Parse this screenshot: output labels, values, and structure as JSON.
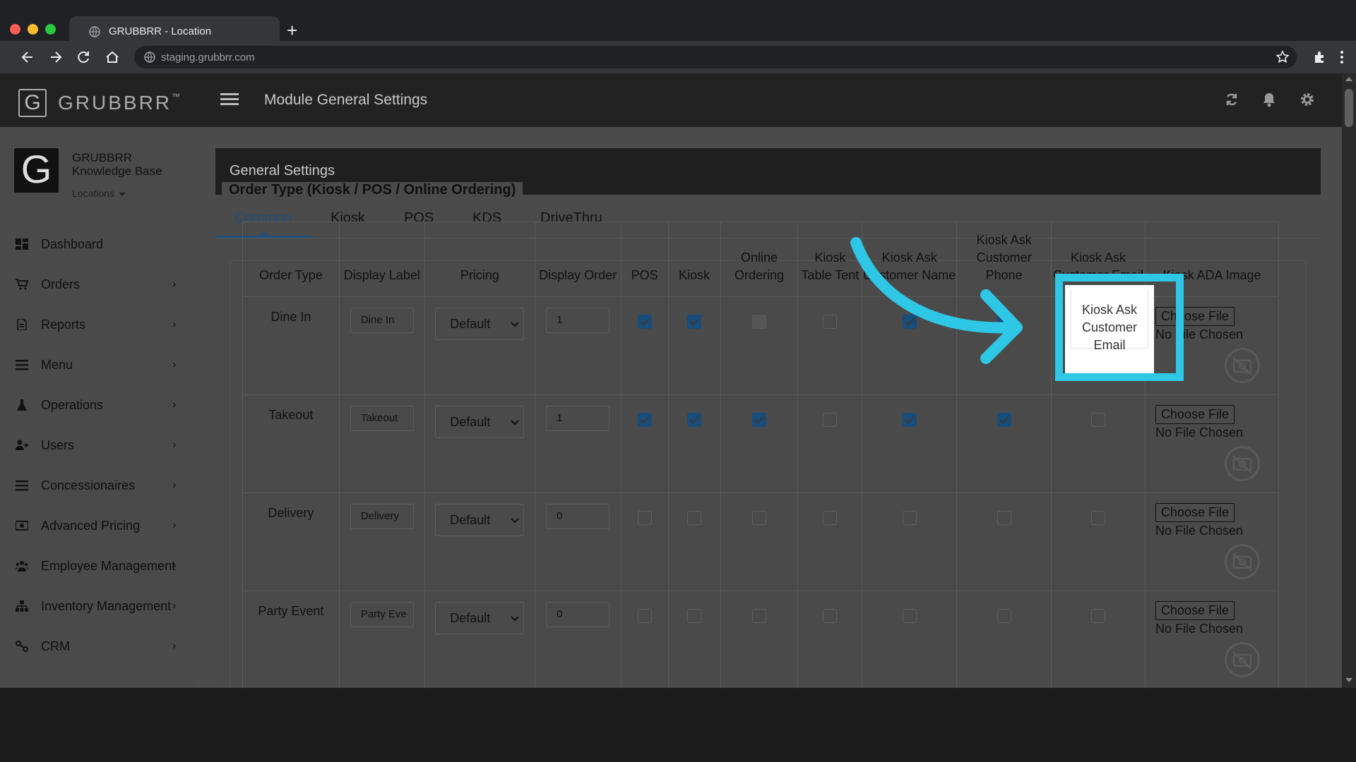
{
  "browser": {
    "tab_title": "GRUBBRR - Location",
    "new_tab": "+",
    "url": "staging.grubbrr.com"
  },
  "header": {
    "logo_letter": "G",
    "brand": "GRUBBRR",
    "trademark": "™",
    "title": "Module General Settings"
  },
  "sidebar": {
    "org_logo_letter": "G",
    "org_name": "GRUBBRR Knowledge Base",
    "locations_label": "Locations",
    "items": [
      {
        "label": "Dashboard",
        "icon": "dashboard-icon",
        "chevron": ""
      },
      {
        "label": "Orders",
        "icon": "cart-icon",
        "chevron": "›"
      },
      {
        "label": "Reports",
        "icon": "report-icon",
        "chevron": "›"
      },
      {
        "label": "Menu",
        "icon": "menu-list-icon",
        "chevron": "›"
      },
      {
        "label": "Operations",
        "icon": "flask-icon",
        "chevron": "›"
      },
      {
        "label": "Users",
        "icon": "add-user-icon",
        "chevron": "›"
      },
      {
        "label": "Concessionaires",
        "icon": "list-icon",
        "chevron": "›"
      },
      {
        "label": "Advanced Pricing",
        "icon": "money-icon",
        "chevron": "›"
      },
      {
        "label": "Employee Management",
        "icon": "group-icon",
        "chevron": "›"
      },
      {
        "label": "Inventory Management",
        "icon": "sitemap-icon",
        "chevron": "›"
      },
      {
        "label": "CRM",
        "icon": "link-icon",
        "chevron": "›"
      }
    ]
  },
  "main": {
    "card_title": "General Settings",
    "tabs": [
      "Common",
      "Kiosk",
      "POS",
      "KDS",
      "DriveThru"
    ],
    "active_tab": "Common",
    "section_title": "Order Type (Kiosk / POS / Online Ordering)"
  },
  "table": {
    "headers": {
      "order_type": "Order Type",
      "display_label": "Display Label",
      "pricing": "Pricing",
      "display_order": "Display Order",
      "pos": "POS",
      "kiosk": "Kiosk",
      "online_ordering": "Online Ordering",
      "kiosk_table_tent": "Kiosk Table Tent",
      "kiosk_ask_name": "Kiosk Ask Customer Name",
      "kiosk_ask_phone": "Kiosk Ask Customer Phone",
      "kiosk_ask_email": "Kiosk Ask Customer Email",
      "kiosk_ada_image": "Kiosk ADA Image"
    },
    "choose_file_label": "Choose File",
    "no_file_label": "No File Chosen",
    "rows": [
      {
        "order_type": "Dine In",
        "display_label": "Dine In",
        "pricing": "Default",
        "display_order": "1",
        "pos": "on",
        "kiosk": "on",
        "online": "dis",
        "table_tent": "off",
        "ask_name": "on",
        "ask_phone": "on",
        "ask_email": "on"
      },
      {
        "order_type": "Takeout",
        "display_label": "Takeout",
        "pricing": "Default",
        "display_order": "1",
        "pos": "on",
        "kiosk": "on",
        "online": "on",
        "table_tent": "off",
        "ask_name": "on",
        "ask_phone": "on",
        "ask_email": "off"
      },
      {
        "order_type": "Delivery",
        "display_label": "Delivery",
        "pricing": "Default",
        "display_order": "0",
        "pos": "off",
        "kiosk": "off",
        "online": "off",
        "table_tent": "off",
        "ask_name": "off",
        "ask_phone": "off",
        "ask_email": "off"
      },
      {
        "order_type": "Party Event",
        "display_label": "Party Eve",
        "pricing": "Default",
        "display_order": "0",
        "pos": "off",
        "kiosk": "off",
        "online": "off",
        "table_tent": "off",
        "ask_name": "off",
        "ask_phone": "off",
        "ask_email": "off"
      }
    ]
  },
  "highlight": {
    "label": "Kiosk Ask Customer Email",
    "frame_color": "#2ec7e5"
  },
  "colors": {
    "accent": "#164d7c",
    "annotation": "#2ec7e5"
  }
}
